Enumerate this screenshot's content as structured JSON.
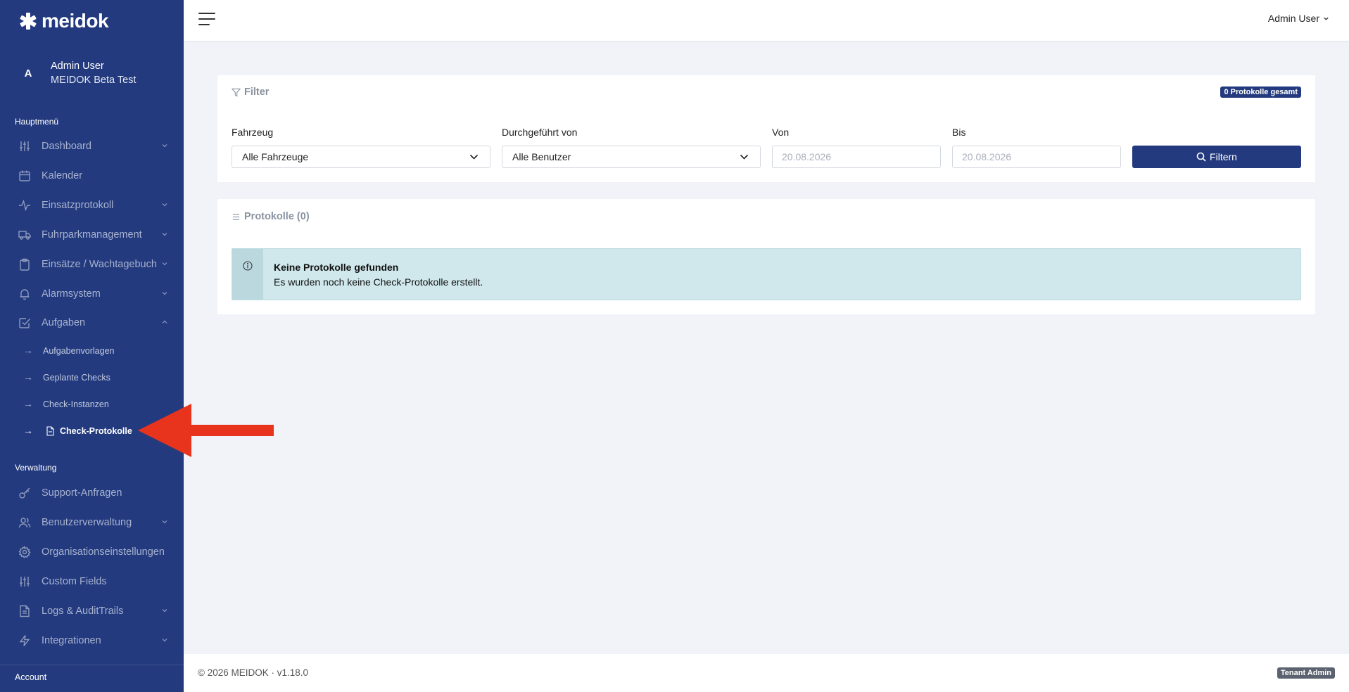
{
  "app": {
    "logo_text": "meidok"
  },
  "sidebar": {
    "user": {
      "initial": "A",
      "name": "Admin User",
      "org": "MEIDOK Beta Test"
    },
    "main_section_label": "Hauptmenü",
    "main_items": [
      {
        "label": "Dashboard",
        "icon": "sliders-icon",
        "has_chevron": true
      },
      {
        "label": "Kalender",
        "icon": "calendar-icon",
        "has_chevron": false
      },
      {
        "label": "Einsatzprotokoll",
        "icon": "activity-icon",
        "has_chevron": true
      },
      {
        "label": "Fuhrparkmanagement",
        "icon": "truck-icon",
        "has_chevron": true
      },
      {
        "label": "Einsätze / Wachtagebuch",
        "icon": "clipboard-icon",
        "has_chevron": true
      },
      {
        "label": "Alarmsystem",
        "icon": "bell-icon",
        "has_chevron": true
      },
      {
        "label": "Aufgaben",
        "icon": "check-square-icon",
        "has_chevron": true,
        "expanded": true
      }
    ],
    "sub_items": [
      {
        "label": "Aufgabenvorlagen"
      },
      {
        "label": "Geplante Checks"
      },
      {
        "label": "Check-Instanzen"
      },
      {
        "label": "Check-Protokolle",
        "active": true
      }
    ],
    "admin_section_label": "Verwaltung",
    "admin_items": [
      {
        "label": "Support-Anfragen",
        "icon": "key-icon",
        "has_chevron": false
      },
      {
        "label": "Benutzerverwaltung",
        "icon": "users-icon",
        "has_chevron": true
      },
      {
        "label": "Organisationseinstellungen",
        "icon": "gear-icon",
        "has_chevron": false
      },
      {
        "label": "Custom Fields",
        "icon": "sliders-icon",
        "has_chevron": false
      },
      {
        "label": "Logs & AuditTrails",
        "icon": "file-text-icon",
        "has_chevron": true
      },
      {
        "label": "Integrationen",
        "icon": "zap-icon",
        "has_chevron": true
      }
    ],
    "account_label": "Account"
  },
  "topbar": {
    "user_menu": "Admin User"
  },
  "filter": {
    "title": "Filter",
    "count_badge": "0 Protokolle gesamt",
    "vehicle_label": "Fahrzeug",
    "vehicle_value": "Alle Fahrzeuge",
    "performed_by_label": "Durchgeführt von",
    "performed_by_value": "Alle Benutzer",
    "from_label": "Von",
    "from_placeholder": "20.08.2026",
    "to_label": "Bis",
    "to_placeholder": "20.08.2026",
    "button_label": "Filtern"
  },
  "protocols": {
    "title": "Protokolle (0)",
    "empty_title": "Keine Protokolle gefunden",
    "empty_text": "Es wurden noch keine Check-Protokolle erstellt."
  },
  "footer": {
    "copyright": "© 2026 MEIDOK · v1.18.0",
    "role_badge": "Tenant Admin"
  },
  "colors": {
    "sidebar": "#233a7e",
    "accent": "#233a7e",
    "alert_bg": "#d0e8ec",
    "annotation": "#e8341c"
  }
}
